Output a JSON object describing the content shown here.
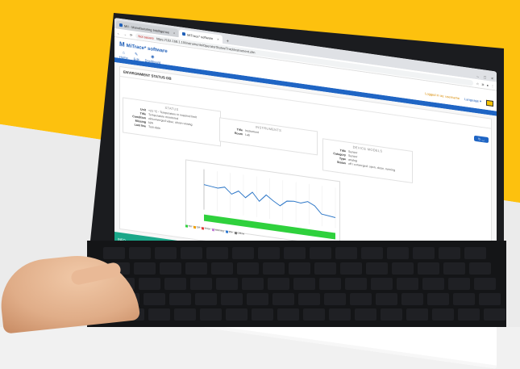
{
  "browser": {
    "tabs": [
      {
        "title": "MII - Manufacturing Intelligence"
      },
      {
        "title": "MiTrace* software"
      }
    ],
    "new_tab": "+",
    "address": {
      "security": "Not secure",
      "url": "https://192.168.1.10/instruments/OperatorStatus/TrackInstrument.cfm"
    },
    "window_controls": [
      "–",
      "□",
      "×"
    ]
  },
  "app": {
    "logo_main": "M",
    "logo_text": "MiTrace* software",
    "menu": [
      {
        "icon": "⌂",
        "label": "Home"
      },
      {
        "icon": "✎",
        "label": "Edit"
      },
      {
        "icon": "◉",
        "label": "Dashboard"
      }
    ],
    "user_info": "Logged in as: username",
    "language": "Language ▾",
    "page_title": "ENVIRONMENT STATUS DB",
    "refresh_button": "↻ ◡"
  },
  "status": {
    "heading": "STATUS",
    "rows": [
      {
        "key": "Unit",
        "value": "+21 °C - Temperature in required limit"
      },
      {
        "key": "Title",
        "value": "Temperature monitored"
      },
      {
        "key": "Condition",
        "value": "ok/converged value: show running"
      },
      {
        "key": "Missing",
        "value": "N/A"
      },
      {
        "key": "Last live",
        "value": "Test data"
      }
    ]
  },
  "instruments": {
    "heading": "INSTRUMENTS",
    "rows": [
      {
        "key": "Title",
        "value": "Instrument"
      },
      {
        "key": "Room",
        "value": "Lab"
      }
    ]
  },
  "device_models": {
    "heading": "DEVICE MODELS",
    "rows": [
      {
        "key": "Title",
        "value": "Sensor"
      },
      {
        "key": "Category",
        "value": "Sensor"
      },
      {
        "key": "Type",
        "value": "analog"
      },
      {
        "key": "Status",
        "value": "off / converged: open, close, running"
      }
    ]
  },
  "chart_data": {
    "type": "line",
    "title": "",
    "series": [
      {
        "values": [
          62,
          60,
          58,
          63,
          48,
          58,
          44,
          60,
          40,
          58,
          46,
          36,
          50,
          52,
          50,
          56,
          48,
          30,
          28,
          26
        ]
      }
    ],
    "ylim": [
      0,
      100
    ],
    "grid": true,
    "status_band_color": "#2fd13d"
  },
  "legend_items": [
    {
      "label": "On",
      "color": "#2fd13d"
    },
    {
      "label": "Off",
      "color": "#f0a000"
    },
    {
      "label": "Error",
      "color": "#e23b3b"
    },
    {
      "label": "Warning",
      "color": "#c27dd6"
    },
    {
      "label": "Idle",
      "color": "#2c77d0"
    },
    {
      "label": "Offline",
      "color": "#777777"
    }
  ],
  "sections": {
    "teal_label": "INFO"
  }
}
